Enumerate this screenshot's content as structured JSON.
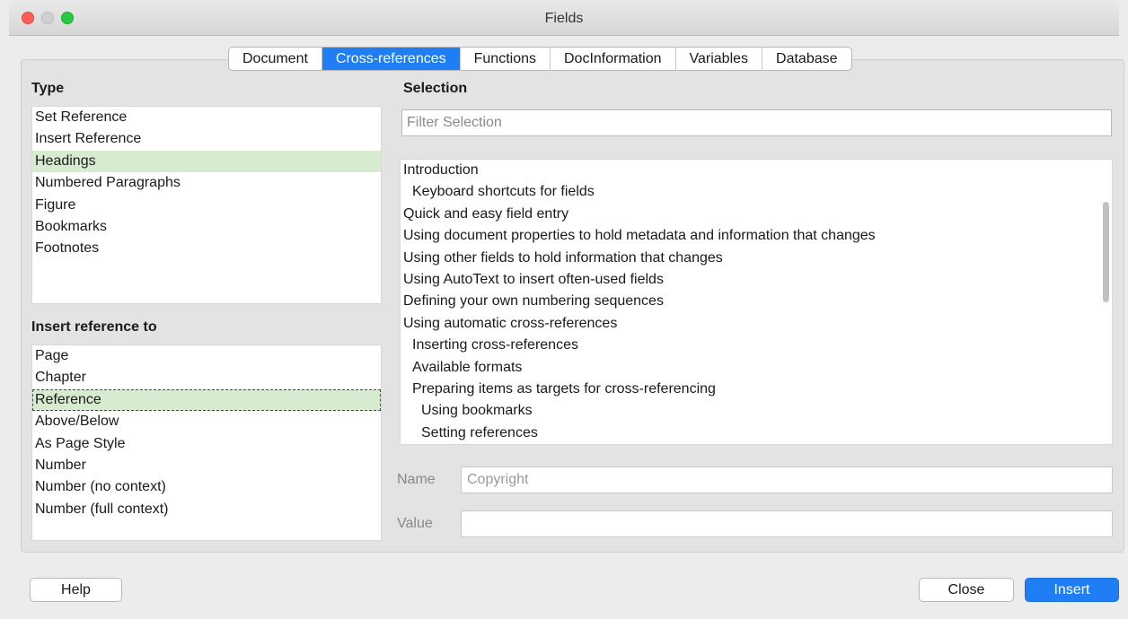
{
  "window": {
    "title": "Fields"
  },
  "tabs": [
    {
      "label": "Document"
    },
    {
      "label": "Cross-references"
    },
    {
      "label": "Functions"
    },
    {
      "label": "DocInformation"
    },
    {
      "label": "Variables"
    },
    {
      "label": "Database"
    }
  ],
  "active_tab": "Cross-references",
  "type_section": {
    "label": "Type",
    "items": [
      {
        "label": "Set Reference"
      },
      {
        "label": "Insert Reference"
      },
      {
        "label": "Headings"
      },
      {
        "label": "Numbered Paragraphs"
      },
      {
        "label": "Figure"
      },
      {
        "label": "Bookmarks"
      },
      {
        "label": "Footnotes"
      }
    ],
    "selected": "Headings"
  },
  "insert_ref_section": {
    "label": "Insert reference to",
    "items": [
      {
        "label": "Page"
      },
      {
        "label": "Chapter"
      },
      {
        "label": "Reference"
      },
      {
        "label": "Above/Below"
      },
      {
        "label": "As Page Style"
      },
      {
        "label": "Number"
      },
      {
        "label": "Number (no context)"
      },
      {
        "label": "Number (full context)"
      }
    ],
    "selected": "Reference"
  },
  "selection_section": {
    "label": "Selection",
    "filter_placeholder": "Filter Selection",
    "items": [
      {
        "label": "Introduction",
        "level": 0
      },
      {
        "label": "Keyboard shortcuts for fields",
        "level": 1
      },
      {
        "label": "Quick and easy field entry",
        "level": 0
      },
      {
        "label": "Using document properties to hold metadata and information that changes",
        "level": 0
      },
      {
        "label": "Using other fields to hold information that changes",
        "level": 0
      },
      {
        "label": "Using AutoText to insert often-used fields",
        "level": 0
      },
      {
        "label": "Defining your own numbering sequences",
        "level": 0
      },
      {
        "label": "Using automatic cross-references",
        "level": 0
      },
      {
        "label": "Inserting cross-references",
        "level": 1
      },
      {
        "label": "Available formats",
        "level": 1
      },
      {
        "label": "Preparing items as targets for cross-referencing",
        "level": 1
      },
      {
        "label": "Using bookmarks",
        "level": 2
      },
      {
        "label": "Setting references",
        "level": 2
      }
    ]
  },
  "name_field": {
    "label": "Name",
    "value": "Copyright"
  },
  "value_field": {
    "label": "Value",
    "value": ""
  },
  "buttons": {
    "help": "Help",
    "close": "Close",
    "insert": "Insert"
  }
}
